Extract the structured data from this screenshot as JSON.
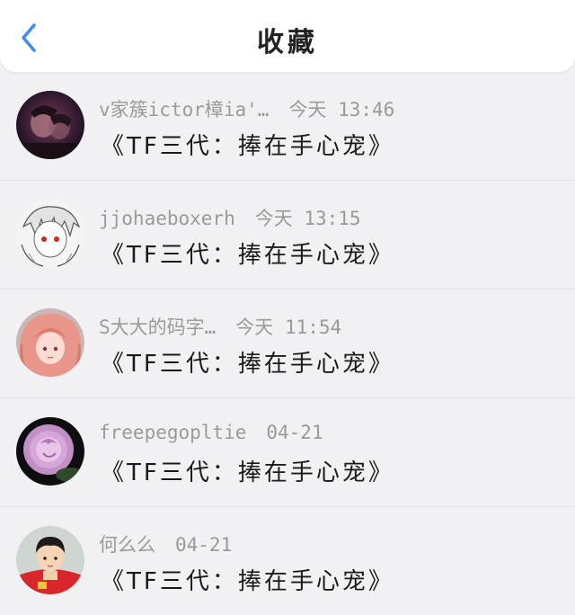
{
  "header": {
    "title": "收藏",
    "back_icon": "chevron-left-icon",
    "accent": "#3a8ef0"
  },
  "items": [
    {
      "author": "v家簇ictor樟ia'…",
      "time": "今天 13:46",
      "work": "《TF三代：捧在手心宠》",
      "avatar": "dark-couple-avatar"
    },
    {
      "author": "jjohaeboxerh",
      "time": "今天 13:15",
      "work": "《TF三代：捧在手心宠》",
      "avatar": "white-hair-anime-avatar"
    },
    {
      "author": "S大大的码字…",
      "time": "今天 11:54",
      "work": "《TF三代：捧在手心宠》",
      "avatar": "pink-hair-anime-avatar"
    },
    {
      "author": "freepegopltie",
      "time": "04-21",
      "work": "《TF三代：捧在手心宠》",
      "avatar": "rose-avatar"
    },
    {
      "author": "何么么",
      "time": "04-21",
      "work": "《TF三代：捧在手心宠》",
      "avatar": "kid-red-coat-avatar"
    }
  ]
}
